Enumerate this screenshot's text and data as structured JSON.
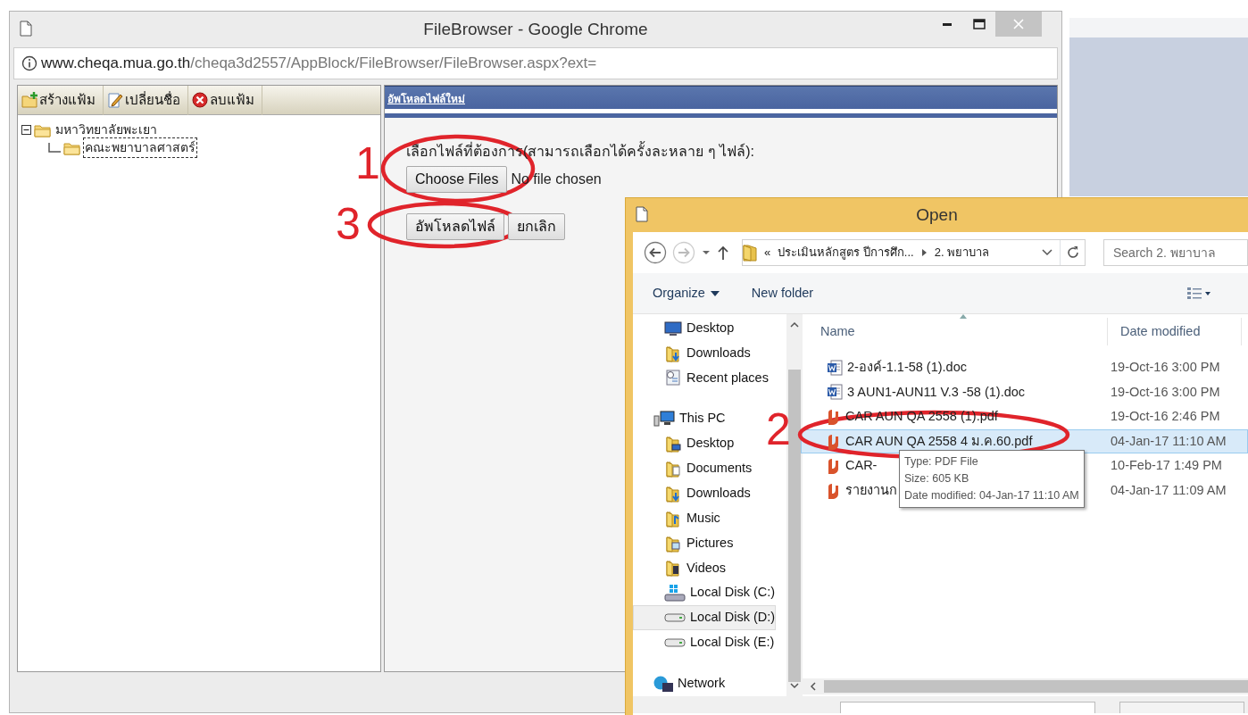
{
  "browser": {
    "title": "FileBrowser - Google Chrome",
    "url_host": "www.cheqa.mua.go.th",
    "url_path": "/cheqa3d2557/AppBlock/FileBrowser/FileBrowser.aspx?ext="
  },
  "toolbar": [
    {
      "label": "สร้างแฟ้ม",
      "kind": "new"
    },
    {
      "label": "เปลี่ยนชื่อ",
      "kind": "rename"
    },
    {
      "label": "ลบแฟ้ม",
      "kind": "delete"
    }
  ],
  "tree": [
    {
      "label": "มหาวิทยาลัยพะเยา",
      "expanded": true,
      "selected": false,
      "children": [
        {
          "label": "คณะพยาบาลศาสตร์",
          "selected": true
        }
      ]
    }
  ],
  "upload": {
    "heading": "อัพโหลดไฟล์ใหม่",
    "prompt": "เลือกไฟล์ที่ต้องการ(สามารถเลือกได้ครั้งละหลาย ๆ ไฟล์):",
    "choose_button": "Choose Files",
    "file_status": "No file chosen",
    "buttons": [
      "อัพโหลดไฟล์",
      "ยกเลิก"
    ]
  },
  "dialog": {
    "title": "Open",
    "path": [
      "«",
      "ประเมินหลักสูตร ปีการศึก...",
      "2. พยาบาล"
    ],
    "search_placeholder": "Search 2. พยาบาล",
    "commands": [
      "Organize",
      "New folder"
    ],
    "nav": [
      {
        "label": "Desktop",
        "kind": "desktop",
        "selected": false
      },
      {
        "label": "Downloads",
        "kind": "downloads",
        "selected": false
      },
      {
        "label": "Recent places",
        "kind": "recent",
        "selected": false
      },
      {
        "label": "This PC",
        "kind": "pc",
        "selected": false,
        "children": [
          {
            "label": "Desktop",
            "kind": "folder-desktop",
            "selected": false
          },
          {
            "label": "Documents",
            "kind": "documents",
            "selected": false
          },
          {
            "label": "Downloads",
            "kind": "downloads",
            "selected": false
          },
          {
            "label": "Music",
            "kind": "music",
            "selected": false
          },
          {
            "label": "Pictures",
            "kind": "pictures",
            "selected": false
          },
          {
            "label": "Videos",
            "kind": "videos",
            "selected": false
          },
          {
            "label": "Local Disk (C:)",
            "kind": "disk-system",
            "selected": false
          },
          {
            "label": "Local Disk (D:)",
            "kind": "disk",
            "selected": true
          },
          {
            "label": "Local Disk (E:)",
            "kind": "disk",
            "selected": false
          }
        ]
      },
      {
        "label": "Network",
        "kind": "network",
        "selected": false
      }
    ],
    "columns": [
      "Name",
      "Date modified"
    ],
    "files": [
      {
        "name": "2-องค์-1.1-58 (1).doc",
        "date": "19-Oct-16 3:00 PM",
        "kind": "doc",
        "selected": false
      },
      {
        "name": "3 AUN1-AUN11 V.3 -58 (1).doc",
        "date": "19-Oct-16 3:00 PM",
        "kind": "doc",
        "selected": false
      },
      {
        "name": "CAR AUN QA 2558 (1).pdf",
        "date": "19-Oct-16 2:46 PM",
        "kind": "pdf",
        "selected": false
      },
      {
        "name": "CAR AUN QA 2558 4 ม.ค.60.pdf",
        "date": "04-Jan-17 11:10 AM",
        "kind": "pdf",
        "selected": true
      },
      {
        "name": "CAR-",
        "date": "10-Feb-17 1:49 PM",
        "kind": "pdf",
        "selected": false
      },
      {
        "name": "รายงานก",
        "date": "04-Jan-17 11:09 AM",
        "kind": "pdf",
        "selected": false
      }
    ],
    "tooltip": [
      "Type: PDF File",
      "Size: 605 KB",
      "Date modified: 04-Jan-17 11:10 AM"
    ]
  },
  "annotations": [
    {
      "number": "1"
    },
    {
      "number": "3"
    },
    {
      "number": "2"
    }
  ]
}
